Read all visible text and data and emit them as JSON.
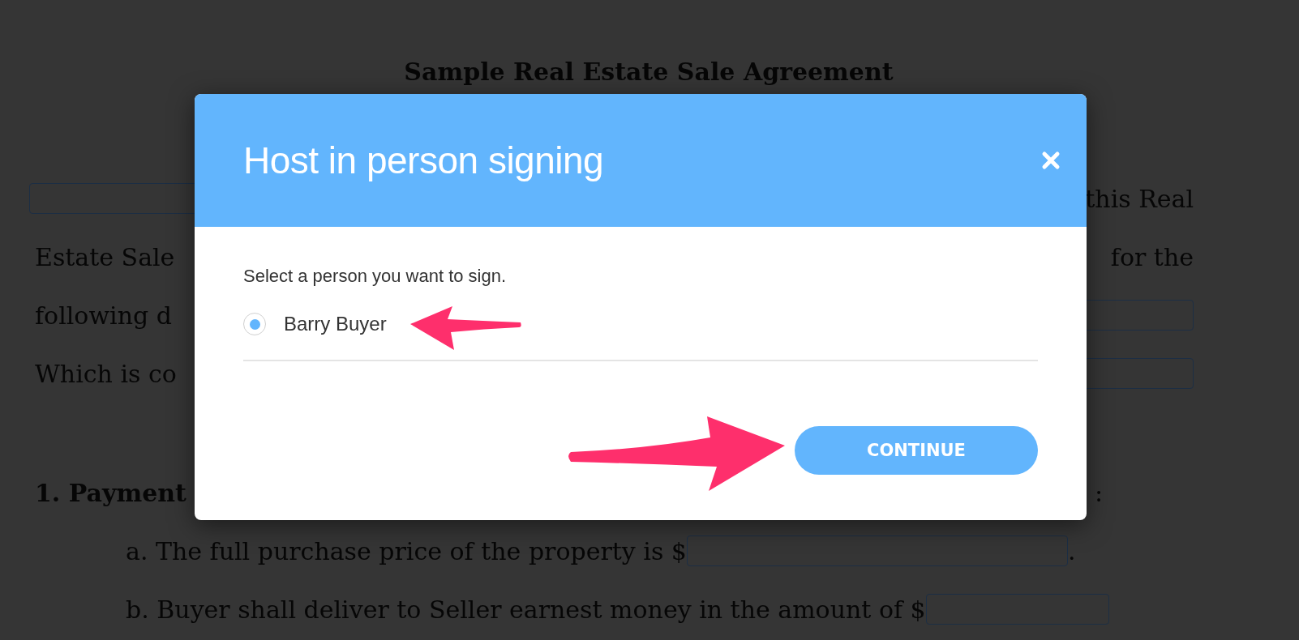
{
  "document": {
    "title": "Sample Real Estate Sale Agreement",
    "lines": [
      {
        "kind": "para",
        "left": [
          {
            "kind": "field"
          }
        ],
        "right": [
          {
            "kind": "text",
            "text": "this Real"
          }
        ]
      },
      {
        "kind": "para",
        "left": [
          {
            "kind": "text",
            "text": "Estate Sale"
          }
        ],
        "right": [
          {
            "kind": "text",
            "text": "for the"
          }
        ]
      },
      {
        "kind": "para",
        "left": [
          {
            "kind": "text",
            "text": "following d"
          }
        ],
        "right": [
          {
            "kind": "field"
          }
        ]
      },
      {
        "kind": "para",
        "left": [
          {
            "kind": "text",
            "text": "Which is co"
          }
        ],
        "right": [
          {
            "kind": "field"
          }
        ]
      },
      {
        "kind": "heading",
        "left": [
          {
            "kind": "text",
            "text": "1. Payment"
          }
        ],
        "right": [
          {
            "kind": "text",
            "text": ":"
          }
        ]
      },
      {
        "kind": "item",
        "left": [
          {
            "kind": "text",
            "text": "a. The full purchase price of the property is $"
          },
          {
            "kind": "field"
          },
          {
            "kind": "text",
            "text": "."
          }
        ]
      },
      {
        "kind": "item",
        "left": [
          {
            "kind": "text",
            "text": "b. Buyer shall deliver to Seller earnest money in the amount of $"
          },
          {
            "kind": "field"
          }
        ]
      }
    ]
  },
  "dialog": {
    "title": "Host in person signing",
    "prompt": "Select a person you want to sign.",
    "people": [
      {
        "name": "Barry Buyer",
        "selected": true
      }
    ],
    "button": "CONTINUE"
  }
}
